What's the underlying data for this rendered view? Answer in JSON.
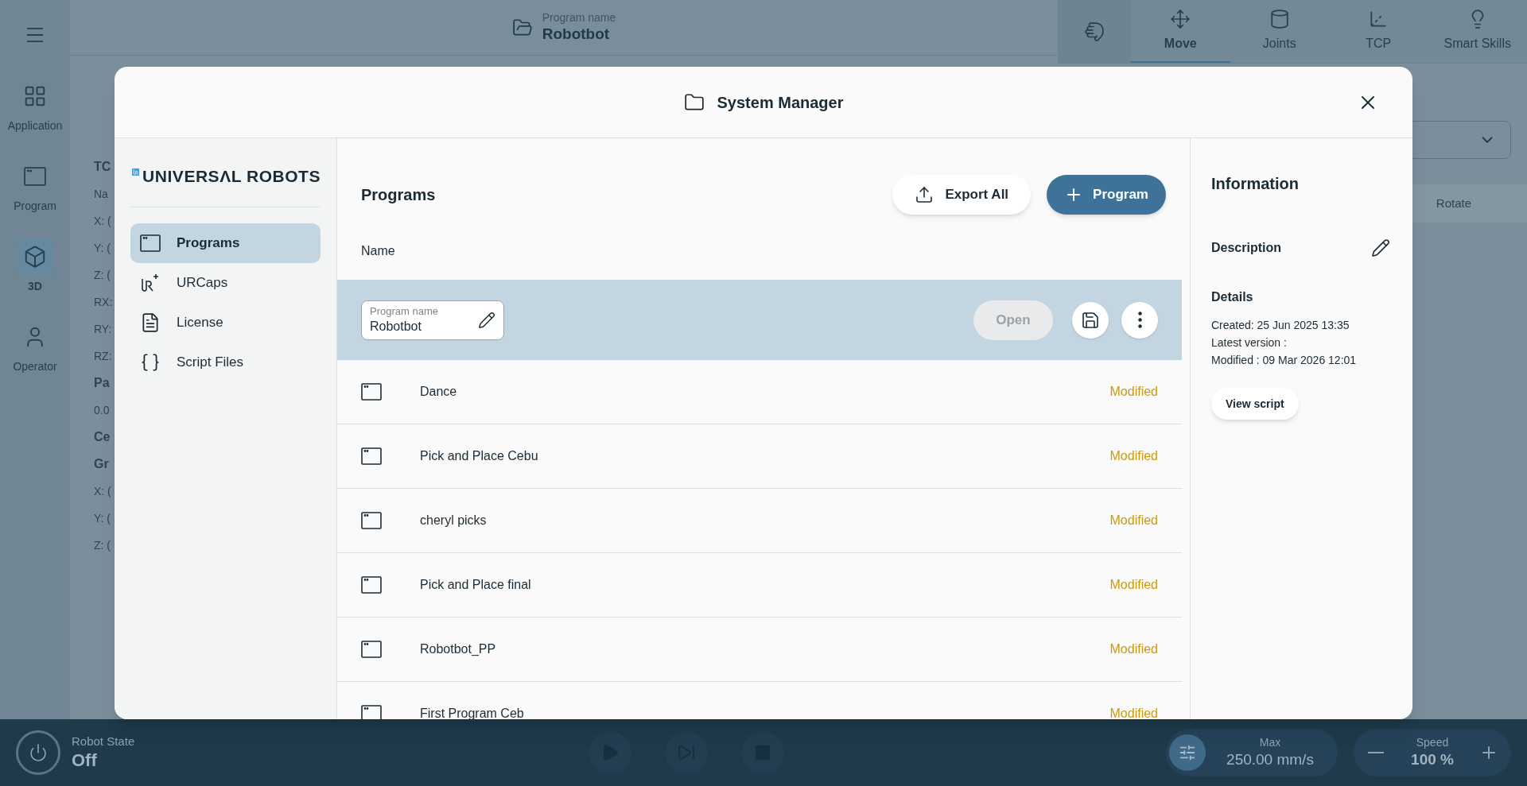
{
  "nav_rail": {
    "items": [
      {
        "label": "Application",
        "kind": "grid",
        "selected": false
      },
      {
        "label": "Program",
        "kind": "program",
        "selected": false
      },
      {
        "label": "3D",
        "kind": "cube",
        "selected": true
      },
      {
        "label": "Operator",
        "kind": "user",
        "selected": false
      }
    ]
  },
  "top_bar": {
    "program_label": "Program name",
    "program_name": "Robotbot"
  },
  "move_tabs": [
    {
      "label": "Move",
      "kind": "move",
      "selected": true
    },
    {
      "label": "Joints",
      "kind": "joints",
      "selected": false
    },
    {
      "label": "TCP",
      "kind": "tcp",
      "selected": false
    },
    {
      "label": "Smart Skills",
      "kind": "bulb",
      "selected": false
    }
  ],
  "background_panel": {
    "lines": [
      {
        "text": "TC",
        "kind": "heading"
      },
      {
        "text": "Na",
        "kind": "value"
      },
      {
        "text": "X: (",
        "kind": "value"
      },
      {
        "text": "Y: (",
        "kind": "value"
      },
      {
        "text": "Z: (",
        "kind": "value"
      },
      {
        "text": "RX:",
        "kind": "value"
      },
      {
        "text": "RY:",
        "kind": "value"
      },
      {
        "text": "RZ:",
        "kind": "value"
      },
      {
        "text": "Pa",
        "kind": "heading"
      },
      {
        "text": "0.0",
        "kind": "value"
      },
      {
        "text": "Ce",
        "kind": "heading"
      },
      {
        "text": "Gr",
        "kind": "heading"
      },
      {
        "text": "X: (",
        "kind": "value"
      },
      {
        "text": "Y: (",
        "kind": "value"
      },
      {
        "text": "Z: (",
        "kind": "value"
      }
    ]
  },
  "background_right": {
    "segment_label": "Rotate"
  },
  "dialog": {
    "title": "System Manager",
    "sidebar": {
      "logo_text": "UNIVERSΛL ROBOTS",
      "items": [
        {
          "label": "Programs",
          "kind": "program",
          "selected": true
        },
        {
          "label": "URCaps",
          "kind": "urcaps",
          "selected": false
        },
        {
          "label": "License",
          "kind": "file",
          "selected": false
        },
        {
          "label": "Script Files",
          "kind": "script",
          "selected": false
        }
      ]
    },
    "programs": {
      "title": "Programs",
      "export_button": "Export All",
      "new_button": "Program",
      "column": "Name",
      "editing": {
        "label": "Program name",
        "value": "Robotbot",
        "open_button": "Open",
        "open_disabled": true
      },
      "rows": [
        {
          "name": "Dance",
          "status": "Modified"
        },
        {
          "name": "Pick and Place Cebu",
          "status": "Modified"
        },
        {
          "name": "cheryl picks",
          "status": "Modified"
        },
        {
          "name": "Pick and Place final",
          "status": "Modified"
        },
        {
          "name": "Robotbot_PP",
          "status": "Modified"
        },
        {
          "name": "First Program Ceb",
          "status": "Modified"
        }
      ]
    },
    "info": {
      "title": "Information",
      "description_label": "Description",
      "details_label": "Details",
      "lines": [
        "Created: 25 Jun 2025 13:35",
        "Latest version :",
        "Modified : 09 Mar 2026 12:01"
      ],
      "view_script_button": "View script"
    }
  },
  "bottom_bar": {
    "robot_state_label": "Robot State",
    "robot_state": "Off",
    "max_label": "Max",
    "max_value": "250.00 mm/s",
    "speed_label": "Speed",
    "speed_value": "100 %"
  }
}
